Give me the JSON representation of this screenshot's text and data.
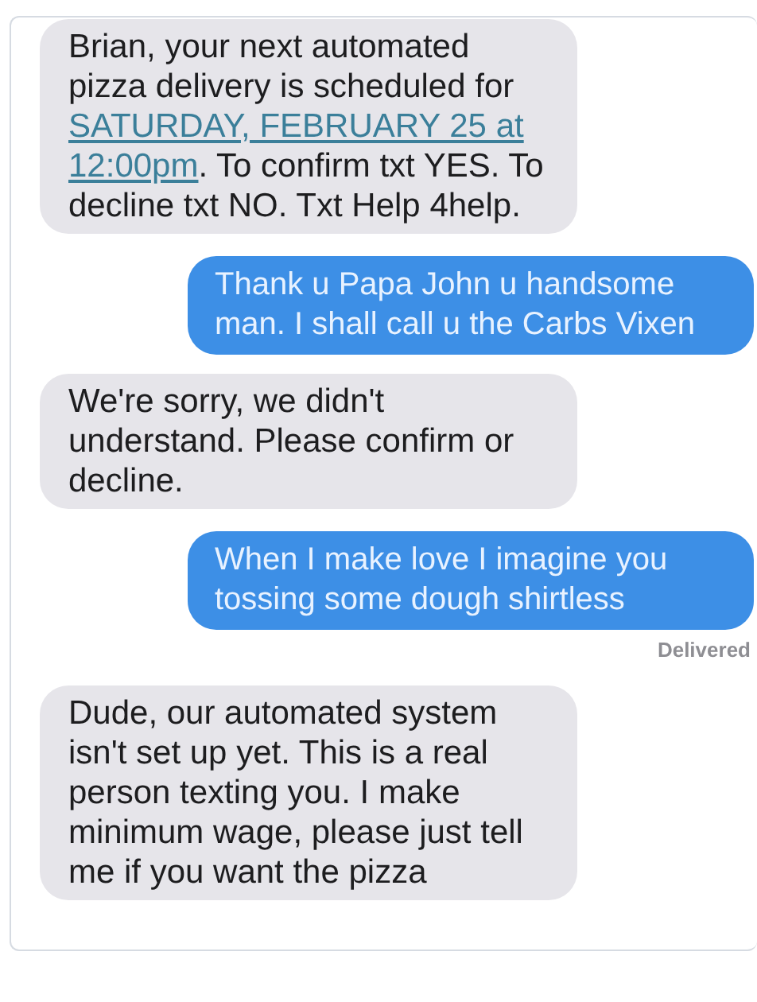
{
  "messages": [
    {
      "kind": "incoming",
      "parts": [
        {
          "kind": "text",
          "text": "Brian, your next automated pizza delivery is scheduled for "
        },
        {
          "kind": "link",
          "text": "SATURDAY, FEBRUARY 25 at"
        },
        {
          "kind": "link",
          "text": "12:00pm"
        },
        {
          "kind": "text",
          "text": ". To confirm txt YES. To decline txt NO. Txt Help 4help."
        }
      ]
    },
    {
      "kind": "outgoing",
      "parts": [
        {
          "kind": "text",
          "text": "Thank u Papa John u handsome man. I shall call u the Carbs Vixen"
        }
      ]
    },
    {
      "kind": "incoming",
      "parts": [
        {
          "kind": "text",
          "text": "We're sorry, we didn't understand. Please confirm or decline."
        }
      ]
    },
    {
      "kind": "outgoing",
      "parts": [
        {
          "kind": "text",
          "text": "When I make love I imagine you tossing some dough shirtless"
        }
      ],
      "status": "Delivered"
    },
    {
      "kind": "incoming",
      "parts": [
        {
          "kind": "text",
          "text": "Dude, our automated system isn't set up yet. This is a real person texting you. I make minimum wage, please just tell me if you want the pizza"
        }
      ]
    }
  ]
}
